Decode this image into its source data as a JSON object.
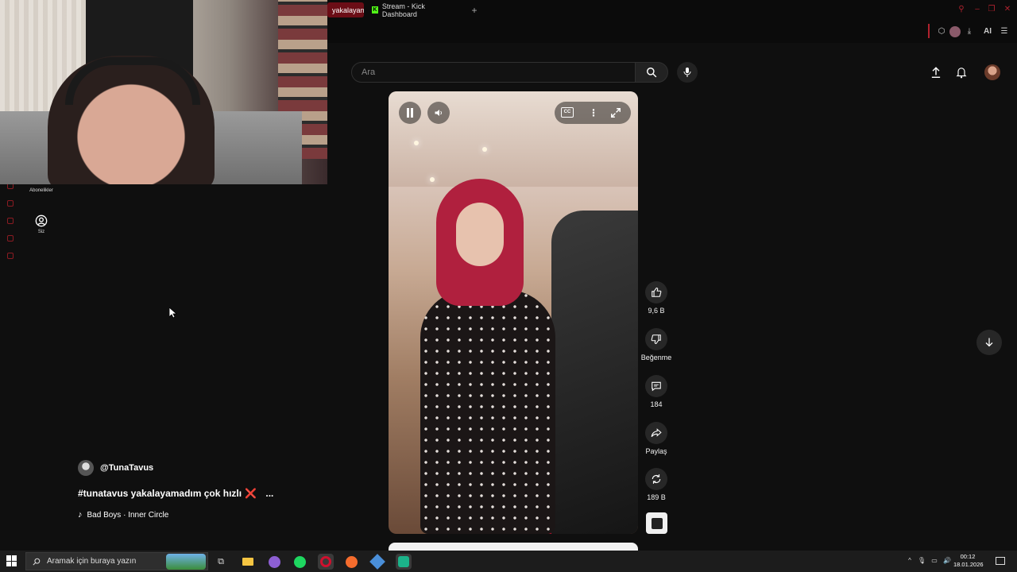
{
  "browser": {
    "tabs": [
      {
        "label": "yakalayam",
        "active": true
      },
      {
        "label": "Stream - Kick Dashboard",
        "active": false
      }
    ],
    "new_tab": "+",
    "toolbar_ai_label": "AI"
  },
  "header": {
    "search_placeholder": "Ara",
    "icons": [
      "search-icon",
      "mic-icon",
      "upload-icon",
      "bell-icon",
      "avatar"
    ]
  },
  "sidebar": {
    "items": [
      {
        "label": "Abonelikler",
        "icon": "subscriptions-icon"
      },
      {
        "label": "Siz",
        "icon": "account-icon"
      }
    ]
  },
  "short": {
    "channel": "@TunaTavus",
    "title": "#tunatavus yakalayamadım çok hızlı",
    "title_emoji": "❌",
    "more": "...",
    "music": "Bad Boys · Inner Circle"
  },
  "actions": {
    "likes": "9,6 B",
    "dislike": "Beğenme",
    "comments": "184",
    "share": "Paylaş",
    "remix": "189 B"
  },
  "taskbar": {
    "search_placeholder": "Aramak için buraya yazın",
    "time": "00:12",
    "date": "18.01.2026"
  },
  "colors": {
    "background": "#0f0f0f",
    "opera_accent": "#b0222e",
    "kick_green": "#53fc18",
    "taskbar": "#1c1c1c"
  }
}
